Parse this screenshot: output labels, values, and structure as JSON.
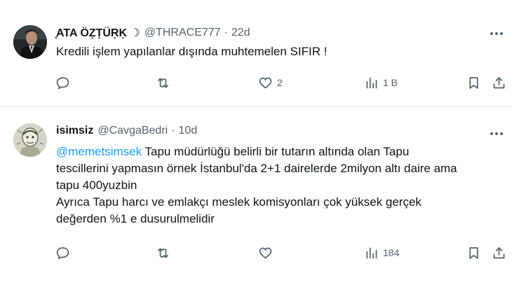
{
  "tweets": [
    {
      "author_name": "̥ATA ÖẒṬÜṚḲ ☽",
      "handle": "@THRACE777",
      "dot": "·",
      "time": "22d",
      "text_lines": [
        {
          "mention": "",
          "text": "Kredili işlem yapılanlar dışında muhtemelen SIFIR !"
        }
      ],
      "actions": {
        "reply": "",
        "retweet": "",
        "like": "2",
        "views": "1 B"
      },
      "avatar_icon": "avatar-man-in-suit-photo"
    },
    {
      "author_name": "isimsiz",
      "handle": "@CavgaBedri",
      "dot": "·",
      "time": "10d",
      "text_lines": [
        {
          "mention": "@memetsimsek",
          "text": " Tapu müdürlüğü belirli bir tutarın altında olan Tapu"
        },
        {
          "mention": "",
          "text": "tescillerini yapmasın örnek İstanbul'da 2+1 dairelerde 2milyon altı daire ama"
        },
        {
          "mention": "",
          "text": "tapu 400yuzbin"
        },
        {
          "mention": "",
          "text": "Ayrıca Tapu harcı ve emlakçı meslek komisyonları çok yüksek gerçek"
        },
        {
          "mention": "",
          "text": "değerden %1 e dusurulmelidir"
        }
      ],
      "actions": {
        "reply": "",
        "retweet": "",
        "like": "",
        "views": "184"
      },
      "avatar_icon": "avatar-sketch-illustration"
    }
  ],
  "colors": {
    "text": "#0f1419",
    "secondary": "#536471",
    "mention": "#1d9bf0",
    "divider": "#e6ecf0"
  }
}
